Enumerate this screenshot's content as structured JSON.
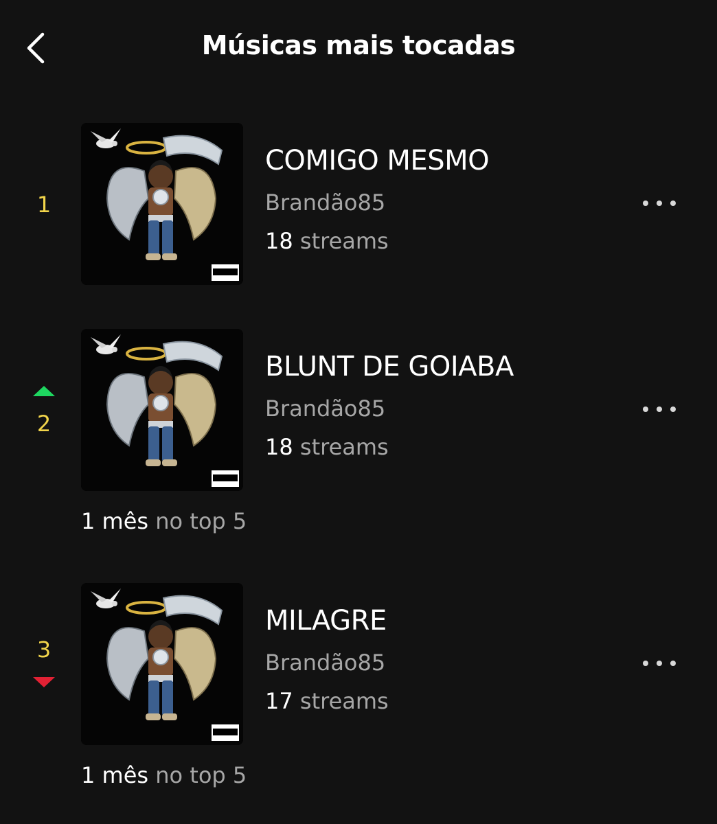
{
  "header": {
    "title": "Músicas mais tocadas",
    "back_icon": "chevron-left-icon"
  },
  "colors": {
    "background": "#121212",
    "rank": "#f2d54b",
    "trend_up": "#1ed760",
    "trend_down": "#e22134",
    "secondary_text": "#a7a7a7"
  },
  "tracks": [
    {
      "rank": "1",
      "trend": "none",
      "title": "COMIGO MESMO",
      "artist": "Brandão85",
      "streams_count": "18",
      "streams_label": "streams",
      "more_icon": "more-horizontal-icon",
      "top5_duration": "",
      "top5_label": ""
    },
    {
      "rank": "2",
      "trend": "up",
      "title": "BLUNT DE GOIABA",
      "artist": "Brandão85",
      "streams_count": "18",
      "streams_label": "streams",
      "more_icon": "more-horizontal-icon",
      "top5_duration": "1 mês",
      "top5_label": "no top 5"
    },
    {
      "rank": "3",
      "trend": "down",
      "title": "MILAGRE",
      "artist": "Brandão85",
      "streams_count": "17",
      "streams_label": "streams",
      "more_icon": "more-horizontal-icon",
      "top5_duration": "1 mês",
      "top5_label": "no top 5"
    }
  ]
}
